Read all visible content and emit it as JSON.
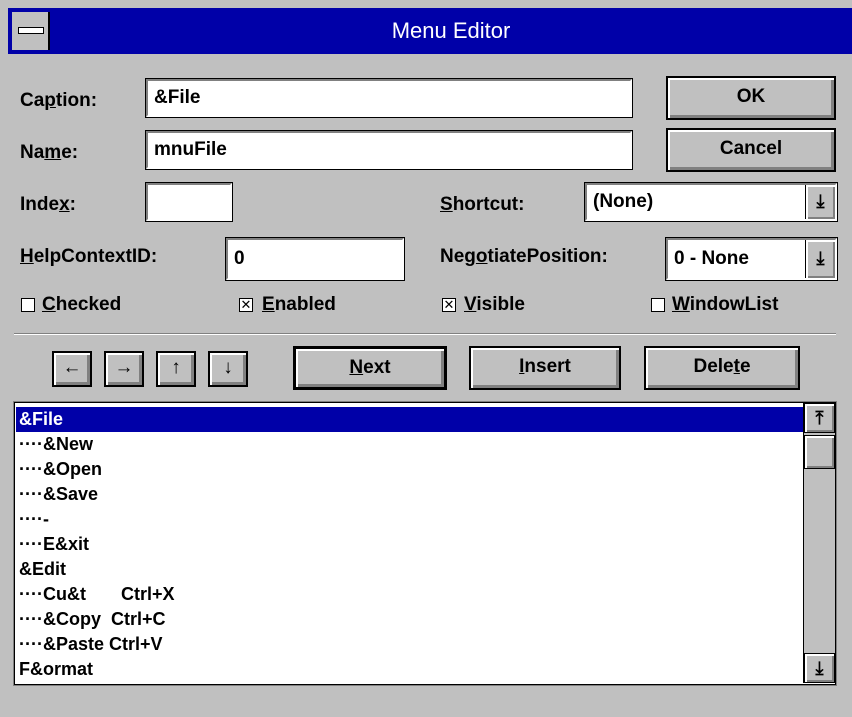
{
  "window": {
    "title": "Menu Editor"
  },
  "labels": {
    "caption": "Caption:",
    "name": "Name:",
    "index": "Index:",
    "shortcut": "Shortcut:",
    "help_context_id": "HelpContextID:",
    "negotiate_position": "NegotiatePosition:"
  },
  "fields": {
    "caption": "&File",
    "name": "mnuFile",
    "index": "",
    "help_context_id": "0",
    "shortcut": "(None)",
    "negotiate_position": "0 - None"
  },
  "buttons": {
    "ok": "OK",
    "cancel": "Cancel",
    "next": "Next",
    "insert": "Insert",
    "delete": "Delete"
  },
  "checkboxes": {
    "checked": {
      "label": "Checked",
      "value": false
    },
    "enabled": {
      "label": "Enabled",
      "value": true
    },
    "visible": {
      "label": "Visible",
      "value": true
    },
    "window_list": {
      "label": "WindowList",
      "value": false
    }
  },
  "arrows": {
    "left": "←",
    "right": "→",
    "up": "↑",
    "down": "↓"
  },
  "menu_list": {
    "selected_index": 0,
    "items": [
      "&File",
      "····&New",
      "····&Open",
      "····&Save",
      "····-",
      "····E&xit",
      "&Edit",
      "····Cu&t       Ctrl+X",
      "····&Copy  Ctrl+C",
      "····&Paste Ctrl+V",
      "F&ormat"
    ]
  },
  "colors": {
    "title_bar": "#0000a8",
    "face": "#c0c0c0",
    "selection": "#0000a8"
  }
}
